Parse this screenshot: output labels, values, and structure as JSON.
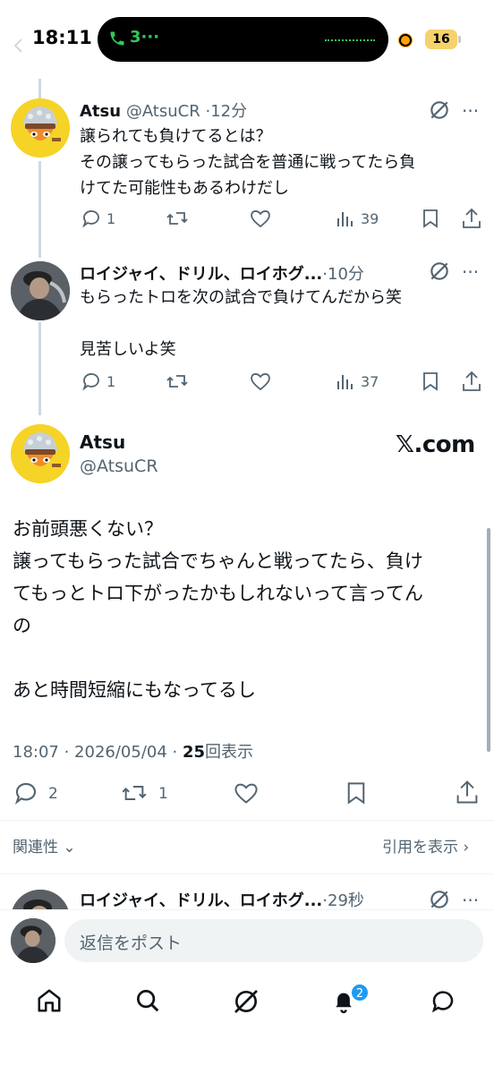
{
  "status_bar": {
    "time": "18:11",
    "call_count": "3···",
    "battery": "16"
  },
  "replies": [
    {
      "name": "Atsu",
      "handle": "@AtsuCR",
      "time": "·12分",
      "lines": [
        "譲られても負けてるとは？",
        "その譲ってもらった試合を普通に戦ってたら負",
        "けてた可能性もあるわけだし"
      ],
      "reply_count": "1",
      "views": "39"
    },
    {
      "name": "ロイジャイ、ドリル、ロイホグ...",
      "handle": "",
      "time": "·10分",
      "lines": [
        "もらったトロを次の試合で負けてんだから笑",
        "",
        "見苦しいよ笑"
      ],
      "reply_count": "1",
      "views": "37"
    }
  ],
  "main_tweet": {
    "name": "Atsu",
    "handle": "@AtsuCR",
    "brand": "𝕏.com",
    "lines": [
      "お前頭悪くない？",
      "譲ってもらった試合でちゃんと戦ってたら、負け",
      "てもっとトロ下がったかもしれないって言ってん",
      "の",
      "",
      "あと時間短縮にもなってるし"
    ],
    "timestamp": "18:07 · 2026/05/04 · ",
    "views_count": "25",
    "views_label": "回表示",
    "reply_count": "2",
    "retweet_count": "1"
  },
  "sort": {
    "related_label": "関連性",
    "quotes_label": "引用を表示"
  },
  "next_reply": {
    "name": "ロイジャイ、ドリル、ロイホグ...",
    "time": "·29秒"
  },
  "composer": {
    "placeholder": "返信をポスト"
  },
  "tabbar": {
    "notifications_badge": "2"
  },
  "colors": {
    "accent": "#1d9bf0",
    "muted": "#536471",
    "thread_line": "#cfd9de"
  }
}
